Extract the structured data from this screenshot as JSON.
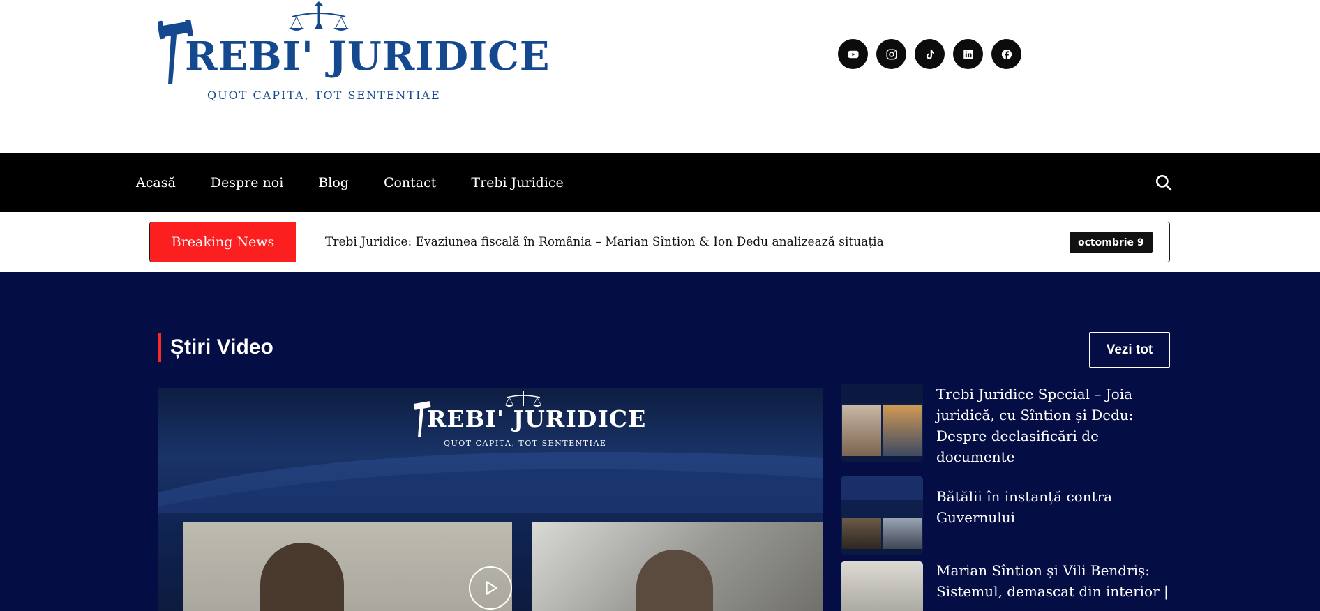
{
  "logo": {
    "title": "REBI' JURIDICE",
    "tagline": "QUOT CAPITA, TOT SENTENTIAE"
  },
  "social": [
    {
      "icon": "youtube-icon"
    },
    {
      "icon": "instagram-icon"
    },
    {
      "icon": "tiktok-icon"
    },
    {
      "icon": "linkedin-icon"
    },
    {
      "icon": "facebook-icon"
    }
  ],
  "nav": {
    "items": [
      "Acasă",
      "Despre noi",
      "Blog",
      "Contact",
      "Trebi Juridice"
    ],
    "search_icon": "search-icon"
  },
  "ticker": {
    "label": "Breaking News",
    "headline": "Trebi Juridice: Evaziunea fiscală în România – Marian Sîntion & Ion Dedu analizează situația",
    "date": "octombrie 9"
  },
  "video_section": {
    "title": "Știri Video",
    "view_all": "Vezi tot",
    "featured": {
      "logo_title": "REBI' JURIDICE",
      "logo_tagline": "QUOT CAPITA, TOT SENTENTIAE",
      "play_icon": "play-icon"
    },
    "items": [
      {
        "title": "Trebi Juridice Special – Joia juridică, cu Sîntion și Dedu: Despre declasificări de documente"
      },
      {
        "title": "Bătălii în instanță contra Guvernului"
      },
      {
        "title": "Marian Sîntion și Vili Bendriș: Sistemul, demascat din interior |"
      }
    ]
  },
  "colors": {
    "brand_blue": "#15498f",
    "breaking_red": "#fb1f1f",
    "section_bg": "#050e44",
    "nav_bg": "#000000"
  }
}
